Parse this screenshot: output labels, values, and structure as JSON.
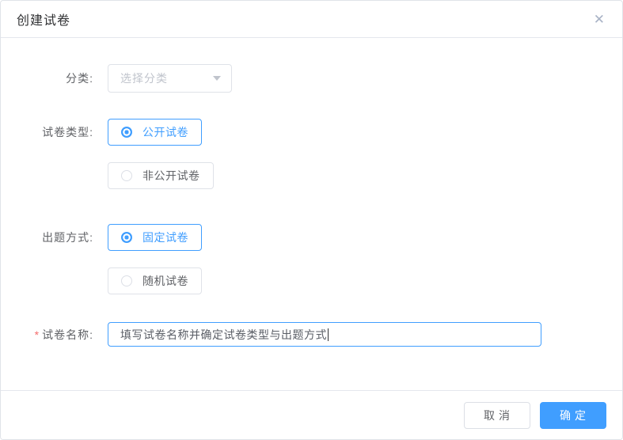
{
  "dialog": {
    "title": "创建试卷"
  },
  "icons": {
    "close": "✕"
  },
  "form": {
    "category": {
      "label": "分类:",
      "placeholder": "选择分类"
    },
    "paper_type": {
      "label": "试卷类型:",
      "options": [
        {
          "label": "公开试卷",
          "selected": true
        },
        {
          "label": "非公开试卷",
          "selected": false
        }
      ]
    },
    "question_mode": {
      "label": "出题方式:",
      "options": [
        {
          "label": "固定试卷",
          "selected": true
        },
        {
          "label": "随机试卷",
          "selected": false
        }
      ]
    },
    "paper_name": {
      "required_mark": "*",
      "label": "试卷名称:",
      "value": "填写试卷名称并确定试卷类型与出题方式"
    }
  },
  "footer": {
    "cancel_label": "取消",
    "confirm_label": "确定"
  },
  "colors": {
    "primary": "#409eff",
    "border": "#dcdfe6",
    "divider": "#e4e7ed",
    "title_text": "#303133",
    "label_text": "#606266",
    "placeholder_text": "#c0c4cc",
    "required_mark": "#f56c6c"
  }
}
